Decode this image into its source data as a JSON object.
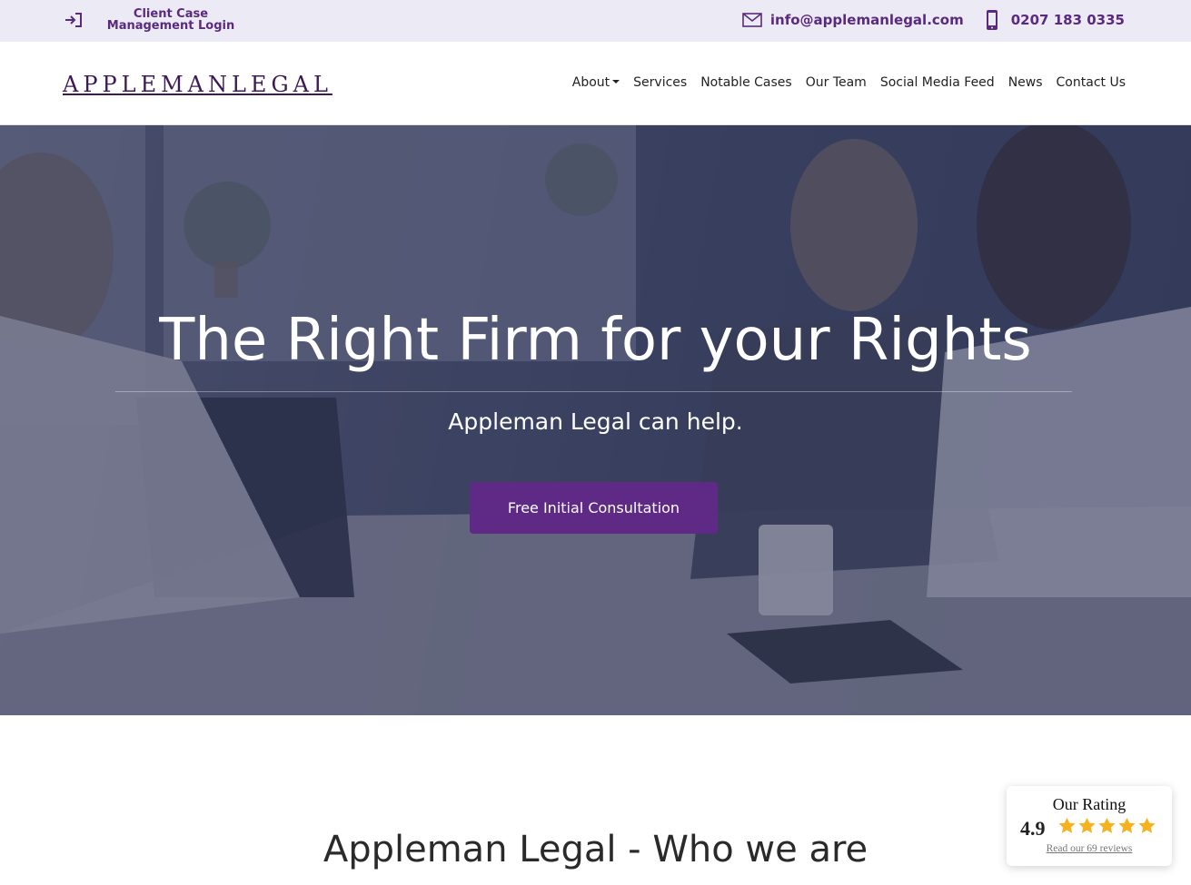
{
  "topbar": {
    "login_label": "Client Case Management Login",
    "email": "info@applemanlegal.com",
    "phone": "0207 183 0335",
    "icons": {
      "login": "login-icon",
      "email": "envelope-icon",
      "phone": "mobile-phone-icon"
    }
  },
  "brand": {
    "logo_text": "APPLEMANLEGAL",
    "primary_color": "#5e2a86"
  },
  "nav": {
    "items": [
      {
        "label": "About",
        "dropdown": true
      },
      {
        "label": "Services"
      },
      {
        "label": "Notable Cases"
      },
      {
        "label": "Our Team"
      },
      {
        "label": "Social Media Feed"
      },
      {
        "label": "News"
      },
      {
        "label": "Contact Us"
      }
    ]
  },
  "hero": {
    "title": "The Right Firm for your Rights",
    "subtitle": "Appleman Legal can help.",
    "cta_label": "Free Initial Consultation"
  },
  "section": {
    "title": "Appleman Legal - Who we are"
  },
  "rating_widget": {
    "title": "Our Rating",
    "score": "4.9",
    "stars": 5,
    "star_color": "#f5b21f",
    "link_text": "Read our 69 reviews"
  }
}
